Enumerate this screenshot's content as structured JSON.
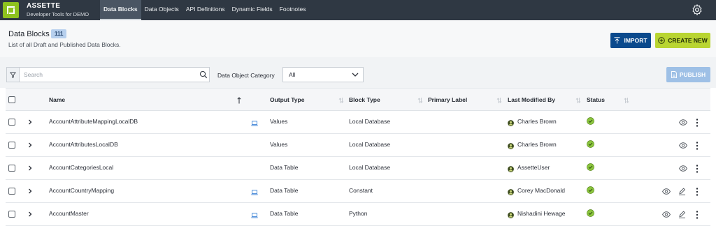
{
  "brand": {
    "name": "ASSETTE",
    "subtitle": "Developer Tools for DEMO"
  },
  "nav": [
    {
      "label": "Data Blocks",
      "active": true
    },
    {
      "label": "Data Objects",
      "active": false
    },
    {
      "label": "API Definitions",
      "active": false
    },
    {
      "label": "Dynamic Fields",
      "active": false
    },
    {
      "label": "Footnotes",
      "active": false
    }
  ],
  "header": {
    "title": "Data Blocks",
    "count": "111",
    "subtitle": "List of all Draft and Published Data Blocks.",
    "import_label": "IMPORT",
    "create_label": "CREATE NEW"
  },
  "filters": {
    "search_placeholder": "Search",
    "category_label": "Data Object Category",
    "category_value": "All",
    "publish_label": "PUBLISH"
  },
  "table": {
    "columns": {
      "name": "Name",
      "output_type": "Output Type",
      "block_type": "Block Type",
      "primary_label": "Primary Label",
      "last_modified_by": "Last Modified By",
      "status": "Status"
    },
    "rows": [
      {
        "name": "AccountAttributeMappingLocalDB",
        "output_type": "Values",
        "block_type": "Local Database",
        "primary_label": "",
        "last_modified_by": "Charles Brown",
        "device": true,
        "editable": false
      },
      {
        "name": "AccountAttributesLocalDB",
        "output_type": "Values",
        "block_type": "Local Database",
        "primary_label": "",
        "last_modified_by": "Charles Brown",
        "device": false,
        "editable": false
      },
      {
        "name": "AccountCategoriesLocal",
        "output_type": "Data Table",
        "block_type": "Local Database",
        "primary_label": "",
        "last_modified_by": "AssetteUser",
        "device": false,
        "editable": false
      },
      {
        "name": "AccountCountryMapping",
        "output_type": "Data Table",
        "block_type": "Constant",
        "primary_label": "",
        "last_modified_by": "Corey MacDonald",
        "device": true,
        "editable": true
      },
      {
        "name": "AccountMaster",
        "output_type": "Data Table",
        "block_type": "Python",
        "primary_label": "",
        "last_modified_by": "Nishadini Hewage",
        "device": true,
        "editable": true
      }
    ]
  },
  "colors": {
    "topbar": "#2f3843",
    "brand_accent": "#8ec21f",
    "import_button": "#0b4a8d",
    "create_button": "#b9d532",
    "publish_button": "#9ec0e6",
    "status_ok": "#8cc63f"
  },
  "icons": {
    "logo": "assette-logo-icon",
    "settings": "gear-icon",
    "filter": "filter-icon",
    "search": "search-icon",
    "import": "upload-icon",
    "create": "plus-circle-icon",
    "publish": "document-icon",
    "expand": "chevron-right-icon",
    "device": "laptop-icon",
    "user": "user-icon",
    "status": "check-circle-icon",
    "view": "eye-icon",
    "edit": "pencil-icon",
    "more": "kebab-menu-icon"
  }
}
